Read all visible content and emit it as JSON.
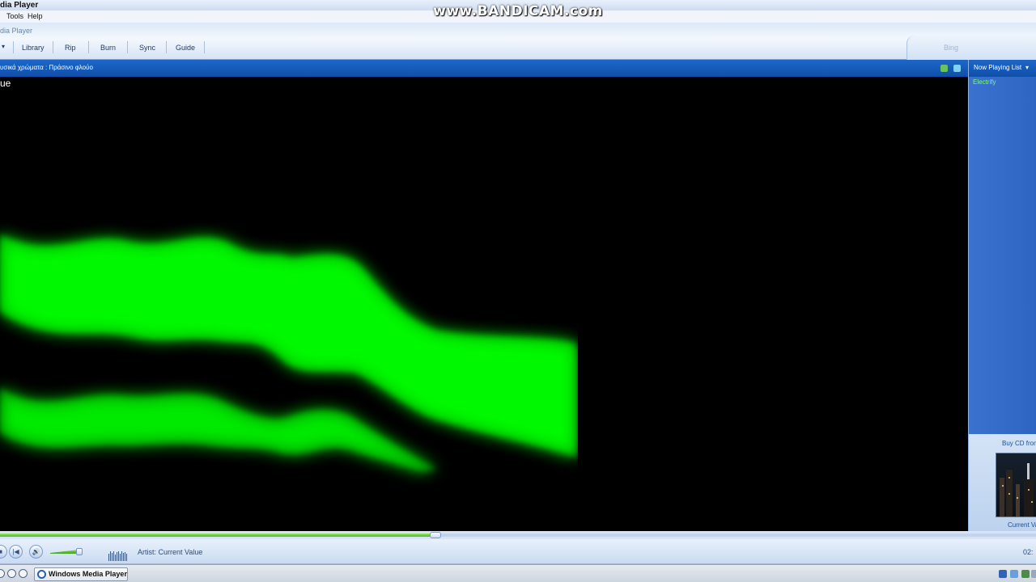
{
  "window": {
    "title": "dia Player",
    "app_title": "dia Player"
  },
  "watermark": "www.BANDICAM.com",
  "menu": {
    "tools": "Tools",
    "help": "Help"
  },
  "nav": {
    "tabs": [
      {
        "label": "Library"
      },
      {
        "label": "Rip"
      },
      {
        "label": "Burn"
      },
      {
        "label": "Sync"
      },
      {
        "label": "Guide"
      }
    ],
    "bing": "Bing"
  },
  "infobar": {
    "visualization": "υσικά χρώματα : Πράσινο φλούο"
  },
  "viz": {
    "caption": "ue",
    "color": "#00ff00"
  },
  "now_playing": {
    "label": "Now Playing List",
    "dropdown_glyph": "▾",
    "items": [
      {
        "title": "Electrify"
      }
    ],
    "buy_cd": "Buy CD from",
    "current_value": "Current Va"
  },
  "seek": {
    "progress": 0.42
  },
  "transport": {
    "artist": "Artist: Current Value",
    "time": "02:",
    "volume": 0.75
  },
  "taskbar": {
    "task_label": "Windows Media Player"
  },
  "colors": {
    "accent": "#1d67c9",
    "viz_green": "#00ff00"
  }
}
